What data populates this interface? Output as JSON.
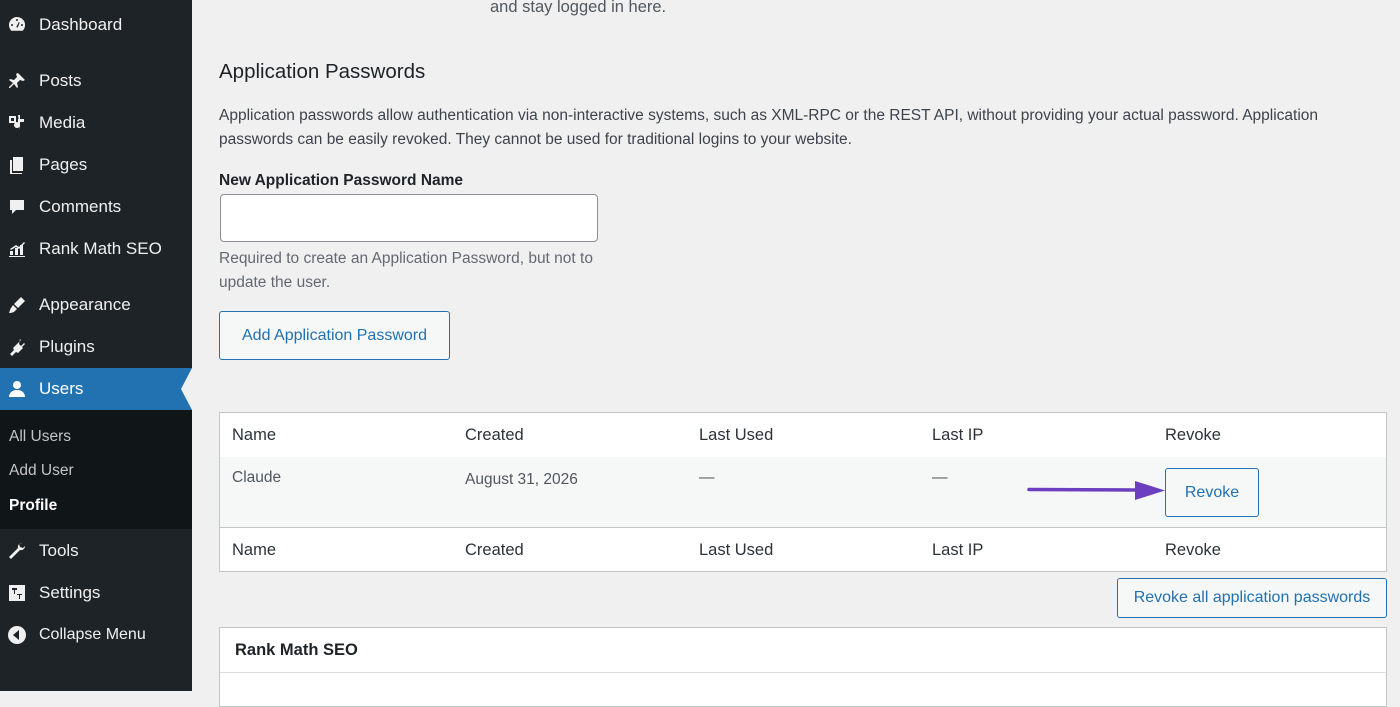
{
  "sidebar": {
    "items": [
      {
        "label": "Dashboard",
        "icon": "dashboard-icon"
      },
      {
        "label": "Posts",
        "icon": "pin-icon"
      },
      {
        "label": "Media",
        "icon": "media-icon"
      },
      {
        "label": "Pages",
        "icon": "pages-icon"
      },
      {
        "label": "Comments",
        "icon": "comments-icon"
      },
      {
        "label": "Rank Math SEO",
        "icon": "rank-math-icon"
      },
      {
        "label": "Appearance",
        "icon": "brush-icon"
      },
      {
        "label": "Plugins",
        "icon": "plugin-icon"
      },
      {
        "label": "Users",
        "icon": "user-icon"
      },
      {
        "label": "Tools",
        "icon": "wrench-icon"
      },
      {
        "label": "Settings",
        "icon": "settings-icon"
      },
      {
        "label": "Collapse Menu",
        "icon": "collapse-icon"
      }
    ],
    "active_item": "Users",
    "submenu": [
      "All Users",
      "Add User",
      "Profile"
    ],
    "current_submenu": "Profile"
  },
  "main": {
    "top_text": "and stay logged in here.",
    "section_title": "Application Passwords",
    "description": "Application passwords allow authentication via non-interactive systems, such as XML-RPC or the REST API, without providing your actual password. Application passwords can be easily revoked. They cannot be used for traditional logins to your website.",
    "field_label": "New Application Password Name",
    "field_value": "",
    "field_help": "Required to create an Application Password, but not to update the user.",
    "add_button": "Add Application Password",
    "table": {
      "columns": [
        "Name",
        "Created",
        "Last Used",
        "Last IP",
        "Revoke"
      ],
      "rows": [
        {
          "name": "Claude",
          "created": "August 31, 2026",
          "last_used": "—",
          "last_ip": "—",
          "revoke": "Revoke"
        }
      ]
    },
    "revoke_all_button": "Revoke all application passwords",
    "next_panel_title": "Rank Math SEO"
  },
  "colors": {
    "sidebar_bg": "#1d2327",
    "active_bg": "#2271b1",
    "link": "#2271b1",
    "annotation_arrow": "#6b3fbf"
  }
}
